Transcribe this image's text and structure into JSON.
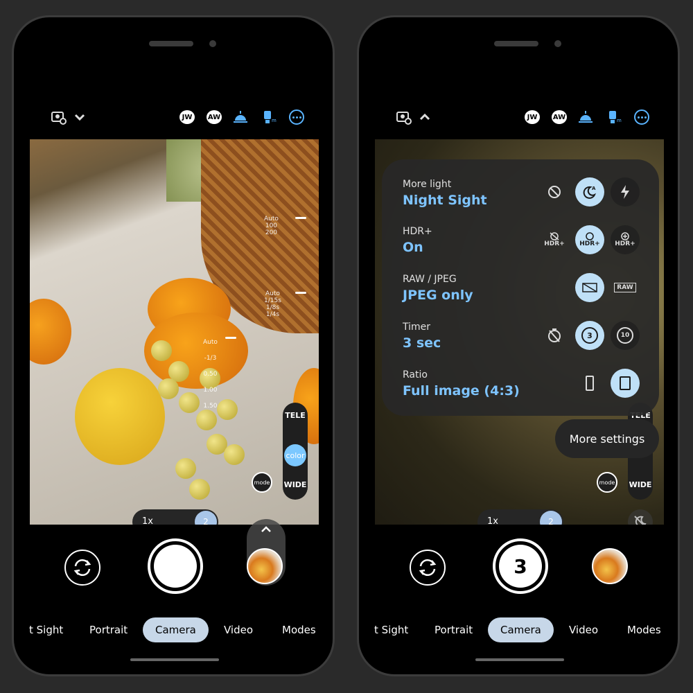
{
  "left": {
    "topbar": {
      "settings_icon": "camera-settings-icon",
      "chevron": "chevron-down-icon",
      "icons": [
        "JW",
        "AW"
      ],
      "more_icon": "more-icon"
    },
    "exposure": {
      "shutter": [
        "Auto",
        "100",
        "200"
      ],
      "iso": [
        "Auto",
        "1/15s",
        "1/8s",
        "1/4s"
      ],
      "ev": [
        "Auto",
        "-1/3",
        "0.50",
        "1.00",
        "1.50"
      ]
    },
    "lens": {
      "tele": "TELE",
      "color": "color",
      "wide": "WIDE",
      "mode": "mode"
    },
    "zoom": {
      "x1": "1x",
      "x2": "2"
    },
    "modes": [
      "t Sight",
      "Portrait",
      "Camera",
      "Video",
      "Modes"
    ]
  },
  "right": {
    "topbar": {
      "settings_icon": "camera-settings-icon",
      "chevron": "chevron-up-icon",
      "icons": [
        "JW",
        "AW"
      ],
      "more_icon": "more-icon"
    },
    "settings": [
      {
        "title": "More light",
        "value": "Night Sight"
      },
      {
        "title": "HDR+",
        "value": "On"
      },
      {
        "title": "RAW / JPEG",
        "value": "JPEG only"
      },
      {
        "title": "Timer",
        "value": "3 sec"
      },
      {
        "title": "Ratio",
        "value": "Full image (4:3)"
      }
    ],
    "options": {
      "hdr_off": "HDR+",
      "hdr_on": "HDR+",
      "hdr_enhanced": "HDR+",
      "raw": "RAW",
      "timer_3": "3",
      "timer_10": "10"
    },
    "more_settings": "More settings",
    "lens": {
      "tele": "TELE",
      "wide": "WIDE",
      "mode": "mode"
    },
    "zoom": {
      "x1": "1x",
      "x2": "2"
    },
    "shutter_countdown": "3",
    "modes": [
      "t Sight",
      "Portrait",
      "Camera",
      "Video",
      "Modes"
    ]
  },
  "colors": {
    "accent": "#7ec4ff",
    "selected": "#bfe0f7",
    "mode_active": "#c7d7e8"
  }
}
